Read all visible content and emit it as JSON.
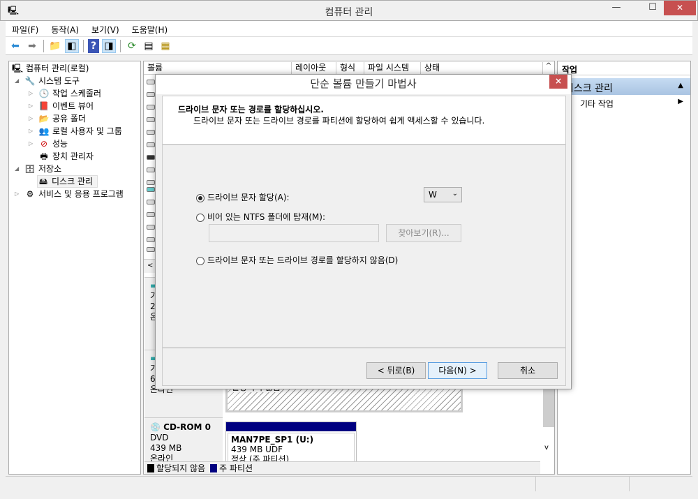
{
  "window": {
    "title": "컴퓨터 관리",
    "minimize": "—",
    "maximize": "☐",
    "close": "✕"
  },
  "menu": [
    "파일(F)",
    "동작(A)",
    "보기(V)",
    "도움말(H)"
  ],
  "toolbar": [
    "back-icon",
    "forward-icon",
    "up-folder-icon",
    "show-hide-tree-icon",
    "help-icon",
    "show-hide-action-icon",
    "refresh-icon",
    "properties-icon",
    "export-icon"
  ],
  "tree": {
    "root": "컴퓨터 관리(로컬)",
    "items": [
      {
        "label": "시스템 도구",
        "level": 1,
        "expanded": true
      },
      {
        "label": "작업 스케줄러",
        "level": 2
      },
      {
        "label": "이벤트 뷰어",
        "level": 2
      },
      {
        "label": "공유 폴더",
        "level": 2
      },
      {
        "label": "로컬 사용자 및 그룹",
        "level": 2
      },
      {
        "label": "성능",
        "level": 2
      },
      {
        "label": "장치 관리자",
        "level": 2
      },
      {
        "label": "저장소",
        "level": 1,
        "expanded": true
      },
      {
        "label": "디스크 관리",
        "level": 2,
        "selected": true
      },
      {
        "label": "서비스 및 응용 프로그램",
        "level": 1
      }
    ]
  },
  "volume_list": {
    "columns": [
      "볼륨",
      "레이아웃",
      "형식",
      "파일 시스템",
      "상태"
    ]
  },
  "disks": [
    {
      "lines": [
        "기",
        "2",
        "온"
      ]
    },
    {
      "lines": [
        "기",
        "6",
        "온라인"
      ],
      "partition": "할당되지 않음"
    },
    {
      "name": "CD-ROM 0",
      "lines": [
        "DVD",
        "439 MB",
        "온라인"
      ],
      "volume": "MAN7PE_SP1  (U:)",
      "volume_info": "439 MB UDF",
      "volume_status": "정상 (주 파티션)"
    }
  ],
  "legend": [
    {
      "label": "할당되지 않음",
      "color": "#000000"
    },
    {
      "label": "주 파티션",
      "color": "#000080"
    }
  ],
  "actions": {
    "header": "작업",
    "section": "디스크 관리",
    "item": "기타 작업"
  },
  "dialog": {
    "title": "단순 볼륨 만들기 마법사",
    "heading": "드라이브 문자 또는 경로를 할당하십시오.",
    "subheading": "드라이브 문자 또는 드라이브 경로를 파티션에 할당하여 쉽게 액세스할 수 있습니다.",
    "options": [
      {
        "label": "드라이브 문자 할당(A):",
        "selected": true
      },
      {
        "label": "비어 있는 NTFS 폴더에 탑재(M):",
        "selected": false
      },
      {
        "label": "드라이브 문자 또는 드라이브 경로를 할당하지 않음(D)",
        "selected": false
      }
    ],
    "drive_letter": "W",
    "folder_path": "",
    "browse": "찾아보기(R)...",
    "back": "< 뒤로(B)",
    "next": "다음(N) >",
    "cancel": "취소"
  }
}
